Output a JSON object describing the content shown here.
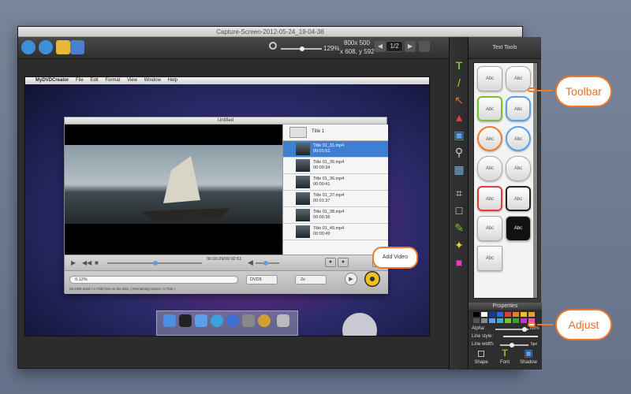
{
  "window": {
    "title": "Capture-Screen-2012-05-24_19-04-38"
  },
  "toolbar": {
    "zoom": "129%",
    "size": "800x  500",
    "coords": "x 608, y 592",
    "page": "1/2"
  },
  "inner_app": {
    "menu": [
      "MyDVDCreator",
      "File",
      "Edit",
      "Format",
      "View",
      "Window",
      "Help"
    ],
    "window_title": "Untitled",
    "playlist_title": "Title 1",
    "playlist": [
      {
        "name": "Title 01_31.mp4",
        "time": "00:01:51"
      },
      {
        "name": "Title 01_35.mp4",
        "time": "00:00:34"
      },
      {
        "name": "Title 01_36.mp4",
        "time": "00:00:41"
      },
      {
        "name": "Title 01_37.mp4",
        "time": "00:01:37"
      },
      {
        "name": "Title 01_38.mp4",
        "time": "00:00:36"
      },
      {
        "name": "Title 01_40.mp4",
        "time": "00:00:49"
      }
    ],
    "timecode": "00:00:29/00:02:51",
    "progress": "0.12%",
    "format": "DVD5",
    "speed": "2x",
    "disc_info": "68.1MB used / 4.7GB free on the disc. ( Remaining Space: 4.7GB )",
    "callout": "Add Video"
  },
  "panel": {
    "title": "Text Tools",
    "tile_label": "Abc",
    "properties": "Properties",
    "alpha_label": "Alpha:",
    "alpha_value": "100%",
    "line_style_label": "Line style:",
    "line_width_label": "Line width:",
    "line_width_value": "5px",
    "btn_shape": "Shape",
    "btn_font": "Font",
    "btn_shadow": "Shadow"
  },
  "annotations": {
    "toolbar": "Toolbar",
    "adjust": "Adjust"
  },
  "colors": {
    "accent": "#f07a2a",
    "selection": "#3e7fd6"
  }
}
